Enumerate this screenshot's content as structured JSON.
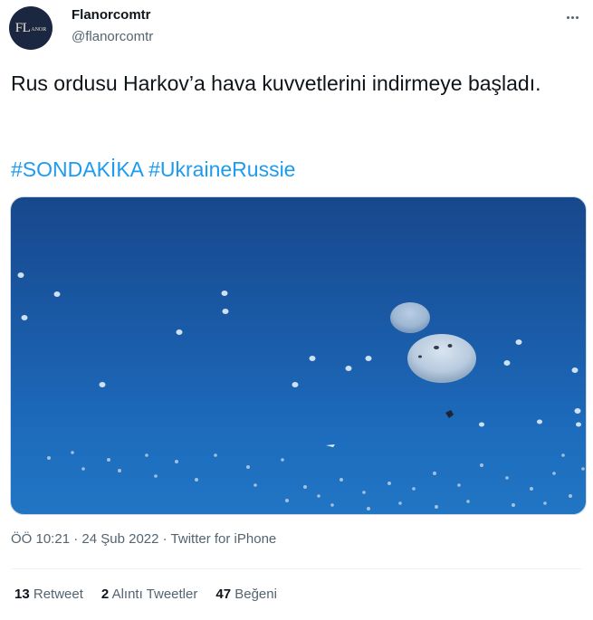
{
  "user": {
    "display_name": "Flanorcomtr",
    "handle": "@flanorcomtr",
    "avatar_text_main": "FL",
    "avatar_text_small": "ANOR"
  },
  "tweet": {
    "text": "Rus ordusu Harkov’a hava kuvvetlerini indirmeye başladı.",
    "hashtags": [
      "#SONDAKİKA",
      "#UkraineRussie"
    ]
  },
  "meta": {
    "time": "ÖÖ 10:21",
    "separator1": " · ",
    "date": "24 Şub 2022",
    "separator2": " · ",
    "source": "Twitter for iPhone"
  },
  "stats": {
    "retweets": {
      "count": "13",
      "label": "Retweet"
    },
    "quotes": {
      "count": "2",
      "label": "Alıntı Tweetler"
    },
    "likes": {
      "count": "47",
      "label": "Beğeni"
    }
  },
  "colors": {
    "accent": "#1d9bf0",
    "text": "#0f1419",
    "muted": "#536471",
    "sky_top": "#17488c",
    "sky_bottom": "#2176c4"
  },
  "icons": {
    "more": "more-horizontal-icon"
  }
}
